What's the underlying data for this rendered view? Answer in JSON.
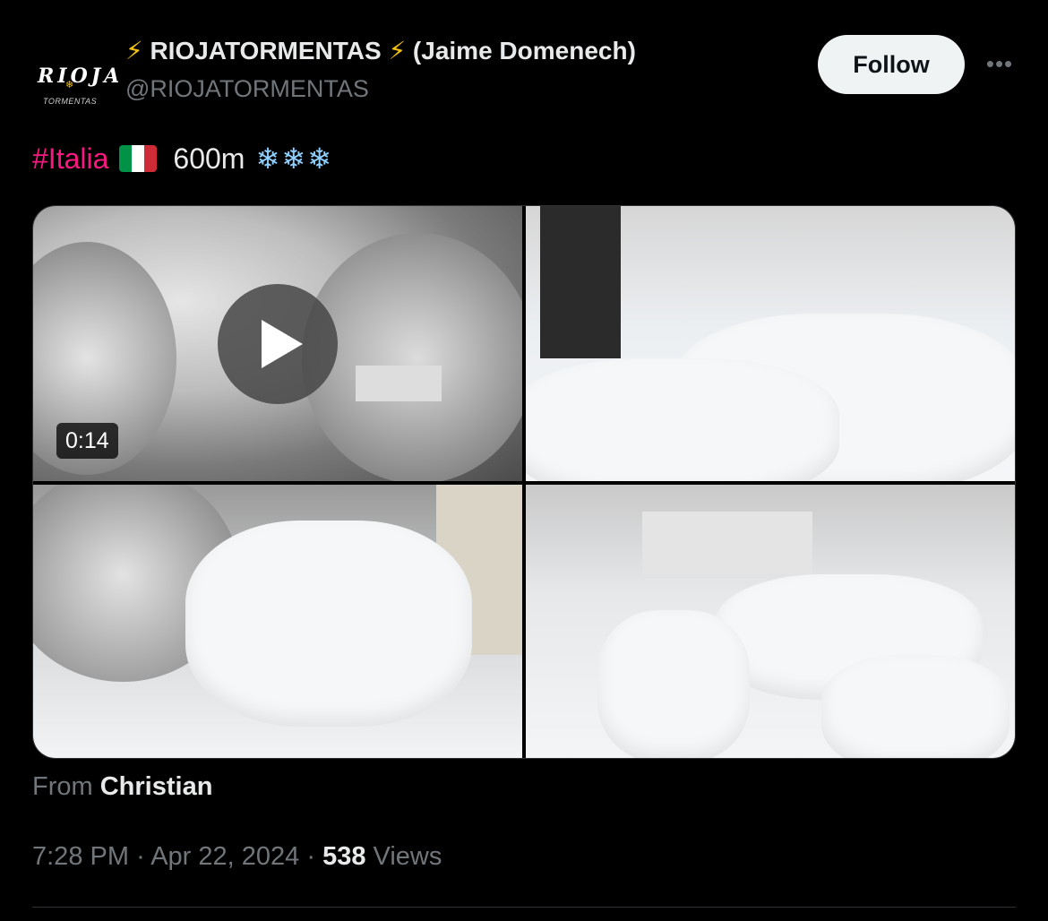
{
  "author": {
    "avatar_logo_text": "RIOJA",
    "avatar_logo_sub": "TORMENTAS",
    "display_name_prefix": "⚡",
    "display_name": "RIOJATORMENTAS",
    "display_name_suffix": "⚡",
    "real_name": "(Jaime Domenech)",
    "handle": "@RIOJATORMENTAS"
  },
  "actions": {
    "follow_label": "Follow",
    "more_label": "•••"
  },
  "tweet": {
    "hashtag": "#Italia",
    "altitude": "600m",
    "snowflakes": "❄❄❄",
    "flag_colors": [
      "#009246",
      "#ffffff",
      "#ce2b37"
    ]
  },
  "media": {
    "video_duration": "0:14"
  },
  "source": {
    "prefix": "From",
    "name": "Christian"
  },
  "meta": {
    "time": "7:28 PM",
    "separator": "·",
    "date": "Apr 22, 2024",
    "views_count": "538",
    "views_label": "Views"
  },
  "colors": {
    "background": "#000000",
    "hashtag": "#f91880",
    "muted": "#71767b",
    "text": "#e7e9ea"
  }
}
